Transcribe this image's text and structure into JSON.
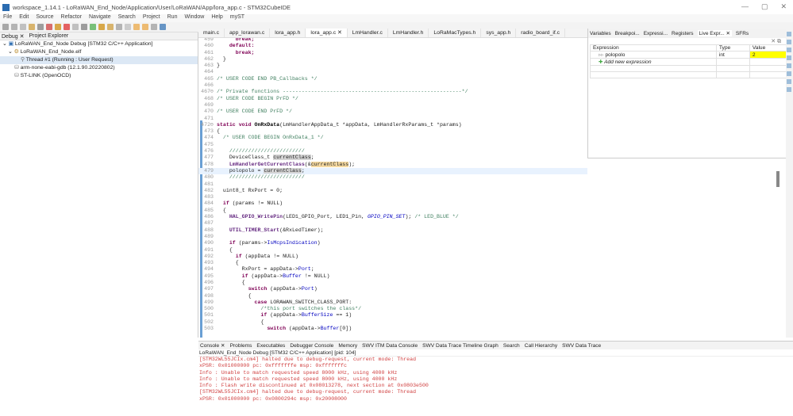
{
  "title": "workspace_1.14.1 - LoRaWAN_End_Node/Application/User/LoRaWAN/App/lora_app.c - STM32CubeIDE",
  "window_controls": [
    "—",
    "▢",
    "✕"
  ],
  "menu": [
    "File",
    "Edit",
    "Source",
    "Refactor",
    "Navigate",
    "Search",
    "Project",
    "Run",
    "Window",
    "Help",
    "myST"
  ],
  "left_panel": {
    "tabs": [
      "Debug ✕",
      "Project Explorer"
    ],
    "tree": [
      "LoRaWAN_End_Node Debug [STM32 C/C++ Application]",
      "LoRaWAN_End_Node.elf",
      "Thread #1 (Running : User Request)",
      "arm-none-eabi-gdb (12.1.90.20220802)",
      "ST-LINK (OpenOCD)"
    ]
  },
  "editor": {
    "tabs": [
      "main.c",
      "app_lorawan.c",
      "lora_app.h",
      "lora_app.c ✕",
      "LmHandler.c",
      "LmHandler.h",
      "LoRaMacTypes.h",
      "sys_app.h",
      "radio_board_if.c"
    ],
    "lines": [
      {
        "n": "459",
        "s": [
          [
            "      ",
            ""
          ],
          [
            "break;",
            "kw"
          ]
        ]
      },
      {
        "n": "460",
        "s": [
          [
            "    ",
            ""
          ],
          [
            "default:",
            "kw"
          ]
        ]
      },
      {
        "n": "461",
        "s": [
          [
            "      ",
            ""
          ],
          [
            "break;",
            "kw"
          ]
        ]
      },
      {
        "n": "462",
        "s": [
          [
            "  }",
            ""
          ]
        ]
      },
      {
        "n": "463",
        "s": [
          [
            "}",
            ""
          ]
        ]
      },
      {
        "n": "464",
        "s": []
      },
      {
        "n": "465",
        "s": [
          [
            "/* USER CODE END PB_Callbacks */",
            "cm"
          ]
        ]
      },
      {
        "n": "466",
        "s": []
      },
      {
        "n": "467⊖",
        "s": [
          [
            "/* Private functions ---------------------------------------------------------*/",
            "cm"
          ]
        ]
      },
      {
        "n": "468",
        "s": [
          [
            "/* USER CODE BEGIN PrFD */",
            "cm"
          ]
        ]
      },
      {
        "n": "469",
        "s": []
      },
      {
        "n": "470",
        "s": [
          [
            "/* USER CODE END PrFD */",
            "cm"
          ]
        ]
      },
      {
        "n": "471",
        "s": []
      },
      {
        "n": "472⊖",
        "s": [
          [
            "static void ",
            "kw"
          ],
          [
            "OnRxData",
            "fn"
          ],
          [
            "(LmHandlerAppData_t *appData, LmHandlerRxParams_t *params)",
            ""
          ]
        ]
      },
      {
        "n": "473",
        "s": [
          [
            "{",
            ""
          ]
        ]
      },
      {
        "n": "474",
        "s": [
          [
            "  ",
            ""
          ],
          [
            "/* USER CODE BEGIN OnRxData_1 */",
            "cm"
          ]
        ]
      },
      {
        "n": "475",
        "s": []
      },
      {
        "n": "476",
        "s": [
          [
            "    ////////////////////////",
            "cm"
          ]
        ]
      },
      {
        "n": "477",
        "s": [
          [
            "    DeviceClass_t ",
            ""
          ],
          [
            "currentClass",
            "hl"
          ],
          [
            ";",
            ""
          ]
        ]
      },
      {
        "n": "478",
        "s": [
          [
            "    ",
            ""
          ],
          [
            "LmHandlerGetCurrentClass",
            "mac"
          ],
          [
            "(&",
            ""
          ],
          [
            "currentClass",
            "hl2"
          ],
          [
            ");",
            ""
          ]
        ]
      },
      {
        "n": "479",
        "s": [
          [
            "    polopolo = ",
            ""
          ],
          [
            "currentClass",
            "hl"
          ],
          [
            ";",
            ""
          ]
        ],
        "cur": true
      },
      {
        "n": "480",
        "s": [
          [
            "    ////////////////////////",
            "cm"
          ]
        ]
      },
      {
        "n": "481",
        "s": []
      },
      {
        "n": "482",
        "s": [
          [
            "  uint8_t RxPort = 0;",
            ""
          ]
        ]
      },
      {
        "n": "483",
        "s": []
      },
      {
        "n": "484",
        "s": [
          [
            "  ",
            ""
          ],
          [
            "if",
            "kw"
          ],
          [
            " (params != NULL)",
            ""
          ]
        ]
      },
      {
        "n": "485",
        "s": [
          [
            "  {",
            ""
          ]
        ]
      },
      {
        "n": "486",
        "s": [
          [
            "    ",
            ""
          ],
          [
            "HAL_GPIO_WritePin",
            "mac"
          ],
          [
            "(LED1_GPIO_Port, LED1_Pin, ",
            ""
          ],
          [
            "GPIO_PIN_SET",
            "it"
          ],
          [
            "); ",
            ""
          ],
          [
            "/* LED_BLUE */",
            "cm"
          ]
        ]
      },
      {
        "n": "487",
        "s": []
      },
      {
        "n": "488",
        "s": [
          [
            "    ",
            ""
          ],
          [
            "UTIL_TIMER_Start",
            "mac"
          ],
          [
            "(&RxLedTimer);",
            ""
          ]
        ]
      },
      {
        "n": "489",
        "s": []
      },
      {
        "n": "490",
        "s": [
          [
            "    ",
            ""
          ],
          [
            "if",
            "kw"
          ],
          [
            " (params->",
            ""
          ],
          [
            "IsMcpsIndication",
            "fld"
          ],
          [
            ")",
            ""
          ]
        ]
      },
      {
        "n": "491",
        "s": [
          [
            "    {",
            ""
          ]
        ]
      },
      {
        "n": "492",
        "s": [
          [
            "      ",
            ""
          ],
          [
            "if",
            "kw"
          ],
          [
            " (appData != NULL)",
            ""
          ]
        ]
      },
      {
        "n": "493",
        "s": [
          [
            "      {",
            ""
          ]
        ]
      },
      {
        "n": "494",
        "s": [
          [
            "        RxPort = appData->",
            ""
          ],
          [
            "Port",
            "fld"
          ],
          [
            ";",
            ""
          ]
        ]
      },
      {
        "n": "495",
        "s": [
          [
            "        ",
            ""
          ],
          [
            "if",
            "kw"
          ],
          [
            " (appData->",
            ""
          ],
          [
            "Buffer",
            "fld"
          ],
          [
            " != NULL)",
            ""
          ]
        ]
      },
      {
        "n": "496",
        "s": [
          [
            "        {",
            ""
          ]
        ]
      },
      {
        "n": "497",
        "s": [
          [
            "          ",
            ""
          ],
          [
            "switch",
            "kw"
          ],
          [
            " (appData->",
            ""
          ],
          [
            "Port",
            "fld"
          ],
          [
            ")",
            ""
          ]
        ]
      },
      {
        "n": "498",
        "s": [
          [
            "          {",
            ""
          ]
        ]
      },
      {
        "n": "499",
        "s": [
          [
            "            ",
            ""
          ],
          [
            "case",
            "kw"
          ],
          [
            " LORAWAN_SWITCH_CLASS_PORT:",
            ""
          ]
        ]
      },
      {
        "n": "500",
        "s": [
          [
            "              ",
            ""
          ],
          [
            "/*this port switches the class*/",
            "cm"
          ]
        ]
      },
      {
        "n": "501",
        "s": [
          [
            "              ",
            ""
          ],
          [
            "if",
            "kw"
          ],
          [
            " (appData->",
            ""
          ],
          [
            "BufferSize",
            "fld"
          ],
          [
            " == 1)",
            ""
          ]
        ]
      },
      {
        "n": "502",
        "s": [
          [
            "              {",
            ""
          ]
        ]
      },
      {
        "n": "503",
        "s": [
          [
            "                ",
            ""
          ],
          [
            "switch",
            "kw"
          ],
          [
            " (appData->",
            ""
          ],
          [
            "Buffer",
            "fld"
          ],
          [
            "[0])",
            ""
          ]
        ]
      }
    ]
  },
  "variables_panel": {
    "tabs": [
      "Variables",
      "Breakpoi...",
      "Expressi...",
      "Registers",
      "Live Expr... ✕",
      "SFRs"
    ],
    "columns": [
      "Expression",
      "Type",
      "Value"
    ],
    "rows": [
      {
        "expression": "polopolo",
        "type": "int",
        "value": "2"
      }
    ],
    "add_label": "Add new expression",
    "highlight": "#ffff00"
  },
  "console": {
    "tabs": [
      "Console ✕",
      "Problems",
      "Executables",
      "Debugger Console",
      "Memory",
      "SWV ITM Data Console",
      "SWV Data Trace Timeline Graph",
      "Search",
      "Call Hierarchy",
      "SWV Data Trace"
    ],
    "session": "LoRaWAN_End_Node Debug [STM32 C/C++ Application]  [pid: 104]",
    "lines": [
      "[STM32WL55JCIx.cm4] halted due to debug-request, current mode: Thread",
      "xPSR: 0x01000000 pc: 0xfffffffe msp: 0xfffffffc",
      "Info : Unable to match requested speed 8000 kHz, using 4000 kHz",
      "Info : Unable to match requested speed 8000 kHz, using 4000 kHz",
      "Info : Flash write discontinued at 0x08013278, next section at 0x0803e500",
      "[STM32WL55JCIx.cm4] halted due to debug-request, current mode: Thread",
      "xPSR: 0x01000000 pc: 0x0800294c msp: 0x20008000"
    ]
  }
}
